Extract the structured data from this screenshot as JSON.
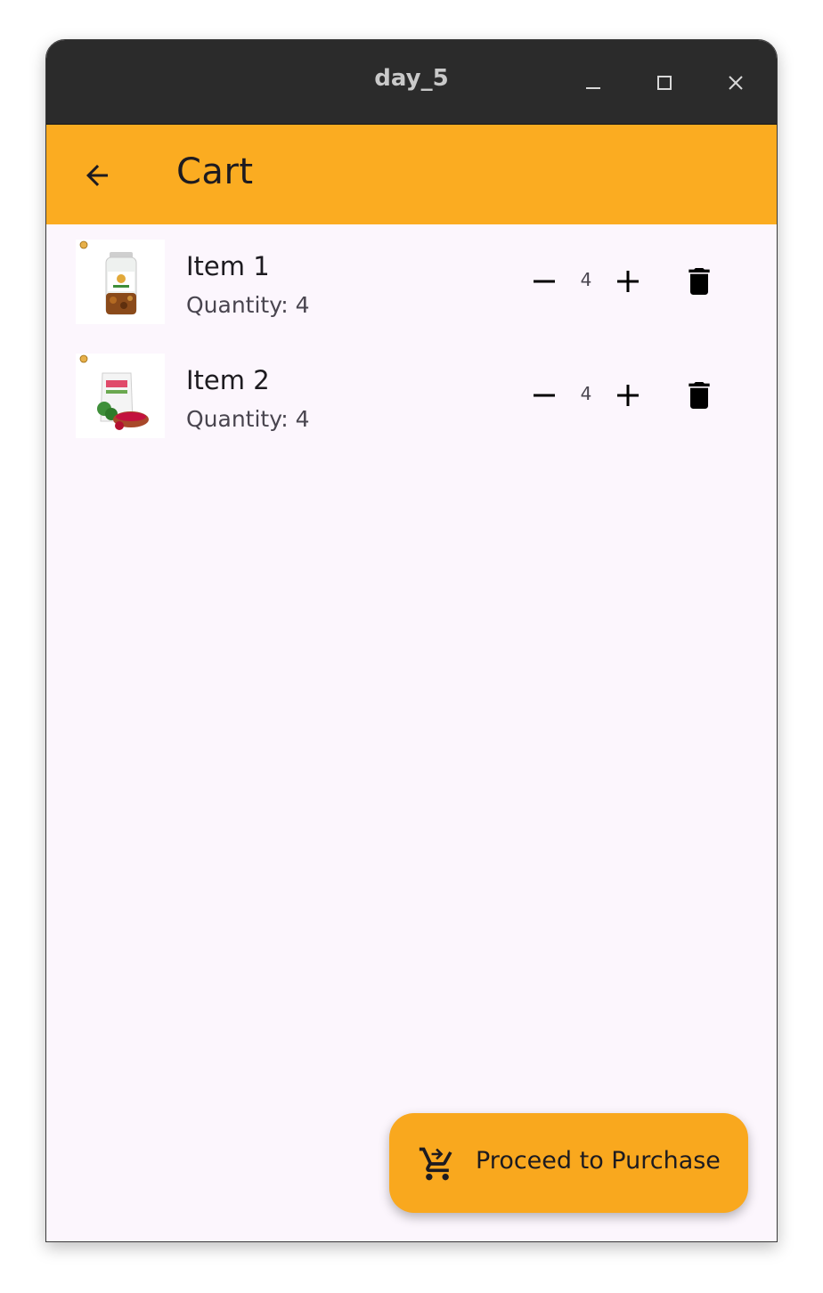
{
  "window": {
    "title": "day_5",
    "controls": [
      "minimize-icon",
      "maximize-icon",
      "close-icon"
    ]
  },
  "appbar": {
    "title": "Cart",
    "back_icon": "arrow-back-icon",
    "color": "#fbac21"
  },
  "cart": {
    "items": [
      {
        "name": "Item 1",
        "quantity_label": "Quantity: 4",
        "quantity": "4",
        "image": "jar-product-image"
      },
      {
        "name": "Item 2",
        "quantity_label": "Quantity: 4",
        "quantity": "4",
        "image": "pouch-product-image"
      }
    ],
    "icons": {
      "decrement": "minus-icon",
      "increment": "plus-icon",
      "delete": "trash-icon"
    }
  },
  "fab": {
    "label": "Proceed to Purchase",
    "icon": "cart-arrow-icon",
    "color": "#f9a81e"
  },
  "colors": {
    "background": "#fcf6fd",
    "titlebar": "#2b2b2b"
  }
}
